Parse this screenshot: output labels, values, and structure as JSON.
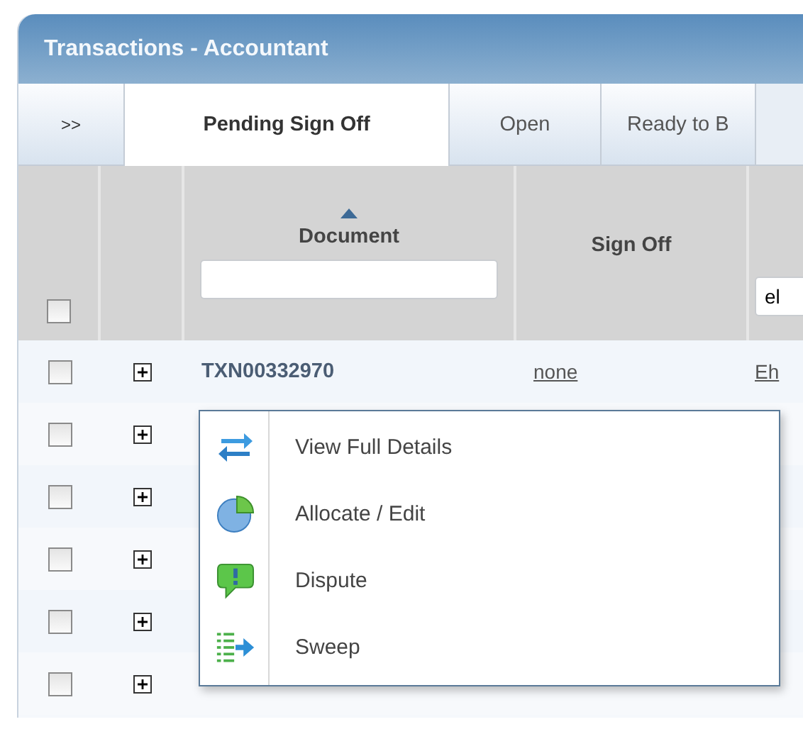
{
  "panel": {
    "title": "Transactions - Accountant"
  },
  "tabs": [
    {
      "label": ">>",
      "kind": "scroll",
      "selected": false
    },
    {
      "label": "Pending Sign Off",
      "kind": "tab",
      "selected": true
    },
    {
      "label": "Open",
      "kind": "tab",
      "selected": false
    },
    {
      "label": "Ready to B",
      "kind": "tab",
      "selected": false
    }
  ],
  "table": {
    "select_all": {
      "checked": false
    },
    "columns": [
      {
        "label": "Document",
        "sorted": true,
        "filterable": true
      },
      {
        "label": "Sign Off"
      },
      {
        "filterable": true,
        "filter": "el"
      }
    ],
    "rows": [
      {
        "checked": false,
        "document": "TXN00332970",
        "sign_off": "none",
        "column_5": "Eh"
      },
      {
        "checked": false
      },
      {
        "checked": false
      },
      {
        "checked": false
      },
      {
        "checked": false
      },
      {
        "checked": false
      }
    ]
  },
  "context_menu": {
    "items": [
      {
        "kind": "details",
        "label": "View Full Details"
      },
      {
        "kind": "allocate",
        "label": "Allocate / Edit"
      },
      {
        "kind": "dispute",
        "label": "Dispute"
      },
      {
        "kind": "sweep",
        "label": "Sweep"
      }
    ]
  }
}
